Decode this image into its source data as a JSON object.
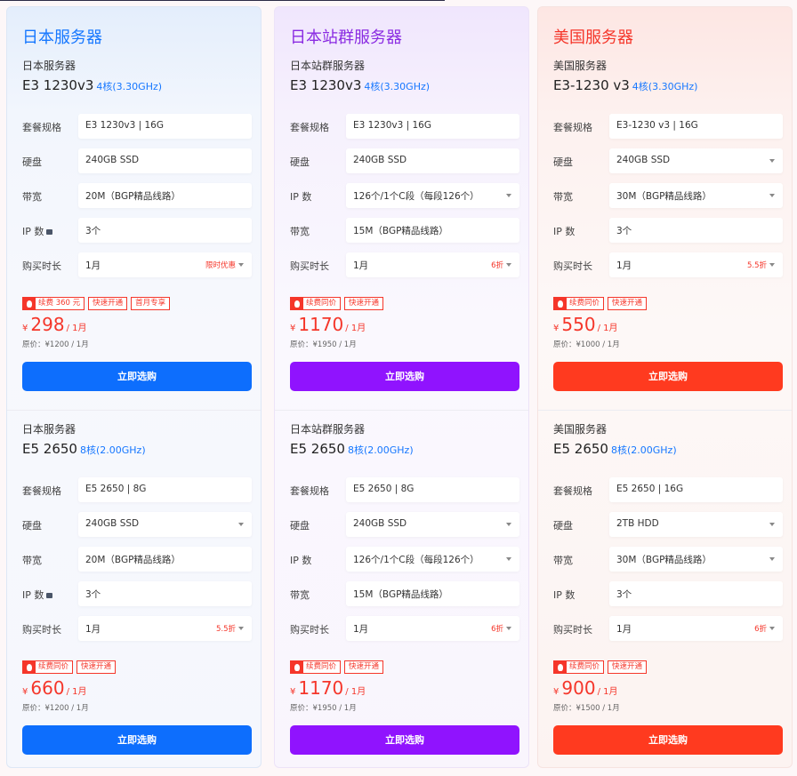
{
  "colors": {
    "blue": "#1677ff",
    "purple": "#9013fe",
    "red": "#ff3a1f",
    "accent_red": "#f5362a"
  },
  "columns": [
    {
      "title": "日本服务器",
      "plans": [
        {
          "name": "日本服务器",
          "cpu_model": "E3 1230v3",
          "cpu_cores": "4核(3.30GHz)",
          "rows": [
            {
              "label": "套餐规格",
              "value": "E3 1230v3 | 16G",
              "tag": "",
              "dropdown": false,
              "info_icon": false
            },
            {
              "label": "硬盘",
              "value": "240GB SSD",
              "tag": "",
              "dropdown": false,
              "info_icon": false
            },
            {
              "label": "带宽",
              "value": "20M（BGP精品线路）",
              "tag": "",
              "dropdown": false,
              "info_icon": false
            },
            {
              "label": "IP 数",
              "value": "3个",
              "tag": "",
              "dropdown": false,
              "info_icon": true
            },
            {
              "label": "购买时长",
              "value": "1月",
              "tag": "限时优惠",
              "dropdown": true,
              "info_icon": false
            }
          ],
          "badges": [
            "续费 360 元",
            "快速开通",
            "首月专享"
          ],
          "currency": "¥",
          "price": "298",
          "period": "/ 1月",
          "original": "原价：¥1200 / 1月",
          "buy_label": "立即选购"
        },
        {
          "name": "日本服务器",
          "cpu_model": "E5 2650",
          "cpu_cores": "8核(2.00GHz)",
          "rows": [
            {
              "label": "套餐规格",
              "value": "E5 2650 | 8G",
              "tag": "",
              "dropdown": false,
              "info_icon": false
            },
            {
              "label": "硬盘",
              "value": "240GB SSD",
              "tag": "",
              "dropdown": true,
              "info_icon": false
            },
            {
              "label": "带宽",
              "value": "20M（BGP精品线路）",
              "tag": "",
              "dropdown": false,
              "info_icon": false
            },
            {
              "label": "IP 数",
              "value": "3个",
              "tag": "",
              "dropdown": false,
              "info_icon": true
            },
            {
              "label": "购买时长",
              "value": "1月",
              "tag": "5.5折",
              "dropdown": true,
              "info_icon": false
            }
          ],
          "badges": [
            "续费同价",
            "快速开通"
          ],
          "currency": "¥",
          "price": "660",
          "period": "/ 1月",
          "original": "原价：¥1200 / 1月",
          "buy_label": "立即选购"
        }
      ]
    },
    {
      "title": "日本站群服务器",
      "plans": [
        {
          "name": "日本站群服务器",
          "cpu_model": "E3 1230v3",
          "cpu_cores": "4核(3.30GHz)",
          "rows": [
            {
              "label": "套餐规格",
              "value": "E3 1230v3 | 16G",
              "tag": "",
              "dropdown": false,
              "info_icon": false
            },
            {
              "label": "硬盘",
              "value": "240GB SSD",
              "tag": "",
              "dropdown": false,
              "info_icon": false
            },
            {
              "label": "IP 数",
              "value": "126个/1个C段（每段126个）",
              "tag": "",
              "dropdown": true,
              "info_icon": false
            },
            {
              "label": "带宽",
              "value": "15M（BGP精品线路）",
              "tag": "",
              "dropdown": false,
              "info_icon": false
            },
            {
              "label": "购买时长",
              "value": "1月",
              "tag": "6折",
              "dropdown": true,
              "info_icon": false
            }
          ],
          "badges": [
            "续费同价",
            "快速开通"
          ],
          "currency": "¥",
          "price": "1170",
          "period": "/ 1月",
          "original": "原价：¥1950 / 1月",
          "buy_label": "立即选购"
        },
        {
          "name": "日本站群服务器",
          "cpu_model": "E5 2650",
          "cpu_cores": "8核(2.00GHz)",
          "rows": [
            {
              "label": "套餐规格",
              "value": "E5 2650 | 8G",
              "tag": "",
              "dropdown": false,
              "info_icon": false
            },
            {
              "label": "硬盘",
              "value": "240GB SSD",
              "tag": "",
              "dropdown": true,
              "info_icon": false
            },
            {
              "label": "IP 数",
              "value": "126个/1个C段（每段126个）",
              "tag": "",
              "dropdown": true,
              "info_icon": false
            },
            {
              "label": "带宽",
              "value": "15M（BGP精品线路）",
              "tag": "",
              "dropdown": false,
              "info_icon": false
            },
            {
              "label": "购买时长",
              "value": "1月",
              "tag": "6折",
              "dropdown": true,
              "info_icon": false
            }
          ],
          "badges": [
            "续费同价",
            "快速开通"
          ],
          "currency": "¥",
          "price": "1170",
          "period": "/ 1月",
          "original": "原价：¥1950 / 1月",
          "buy_label": "立即选购"
        }
      ]
    },
    {
      "title": "美国服务器",
      "plans": [
        {
          "name": "美国服务器",
          "cpu_model": "E3-1230 v3",
          "cpu_cores": "4核(3.30GHz)",
          "rows": [
            {
              "label": "套餐规格",
              "value": "E3-1230 v3 | 16G",
              "tag": "",
              "dropdown": false,
              "info_icon": false
            },
            {
              "label": "硬盘",
              "value": "240GB SSD",
              "tag": "",
              "dropdown": true,
              "info_icon": false
            },
            {
              "label": "带宽",
              "value": "30M（BGP精品线路）",
              "tag": "",
              "dropdown": true,
              "info_icon": false
            },
            {
              "label": "IP 数",
              "value": "3个",
              "tag": "",
              "dropdown": false,
              "info_icon": false
            },
            {
              "label": "购买时长",
              "value": "1月",
              "tag": "5.5折",
              "dropdown": true,
              "info_icon": false
            }
          ],
          "badges": [
            "续费同价",
            "快速开通"
          ],
          "currency": "¥",
          "price": "550",
          "period": "/ 1月",
          "original": "原价：¥1000 / 1月",
          "buy_label": "立即选购"
        },
        {
          "name": "美国服务器",
          "cpu_model": "E5 2650",
          "cpu_cores": "8核(2.00GHz)",
          "rows": [
            {
              "label": "套餐规格",
              "value": "E5 2650 | 16G",
              "tag": "",
              "dropdown": false,
              "info_icon": false
            },
            {
              "label": "硬盘",
              "value": "2TB HDD",
              "tag": "",
              "dropdown": true,
              "info_icon": false
            },
            {
              "label": "带宽",
              "value": "30M（BGP精品线路）",
              "tag": "",
              "dropdown": true,
              "info_icon": false
            },
            {
              "label": "IP 数",
              "value": "3个",
              "tag": "",
              "dropdown": false,
              "info_icon": false
            },
            {
              "label": "购买时长",
              "value": "1月",
              "tag": "6折",
              "dropdown": true,
              "info_icon": false
            }
          ],
          "badges": [
            "续费同价",
            "快速开通"
          ],
          "currency": "¥",
          "price": "900",
          "period": "/ 1月",
          "original": "原价：¥1500 / 1月",
          "buy_label": "立即选购"
        }
      ]
    }
  ]
}
